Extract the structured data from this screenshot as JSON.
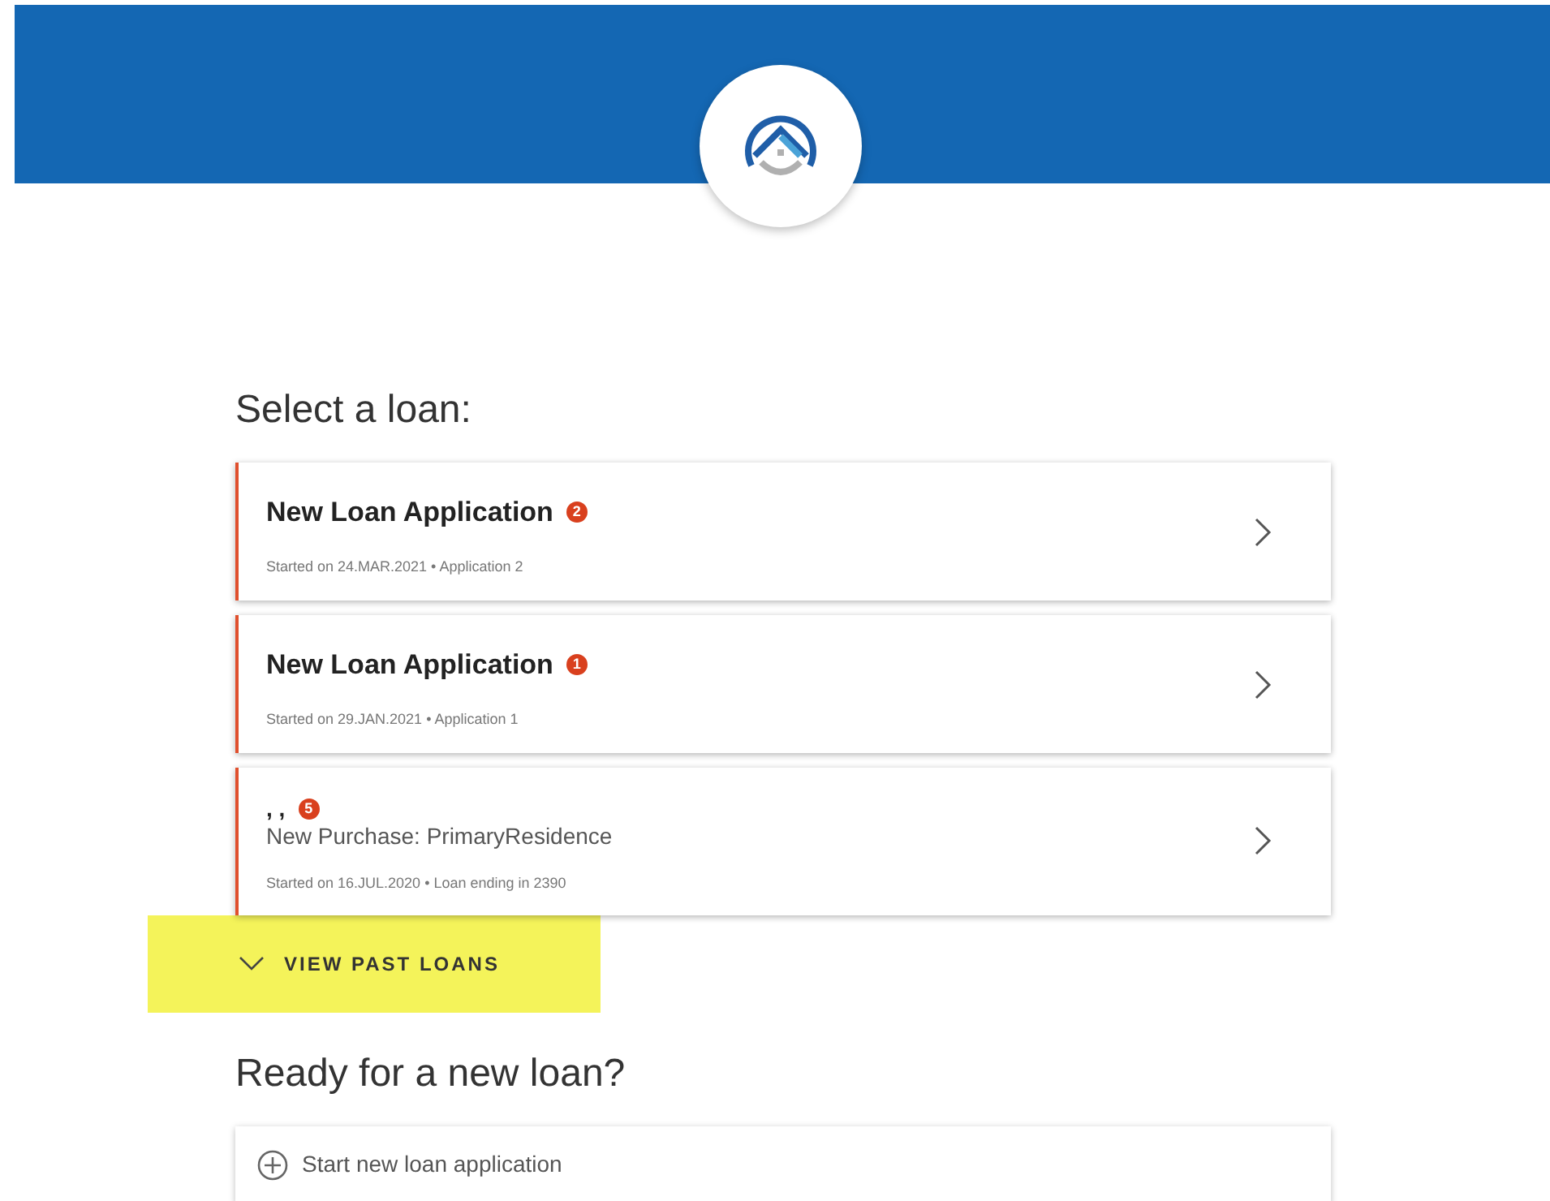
{
  "section_title": "Select a loan:",
  "loans": [
    {
      "kind": "application",
      "title": "New Loan Application",
      "badge": "2",
      "meta": "Started on 24.MAR.2021 • Application 2"
    },
    {
      "kind": "application",
      "title": "New Loan Application",
      "badge": "1",
      "meta": "Started on 29.JAN.2021 • Application 1"
    },
    {
      "kind": "purchase",
      "title": ", ,",
      "badge": "5",
      "subtitle": "New Purchase: PrimaryResidence",
      "meta": "Started on 16.JUL.2020 • Loan ending in 2390"
    }
  ],
  "past_loans": {
    "label": "VIEW PAST LOANS",
    "highlighted": true
  },
  "new_loan": {
    "title": "Ready for a new loan?",
    "action": "Start new loan application"
  }
}
